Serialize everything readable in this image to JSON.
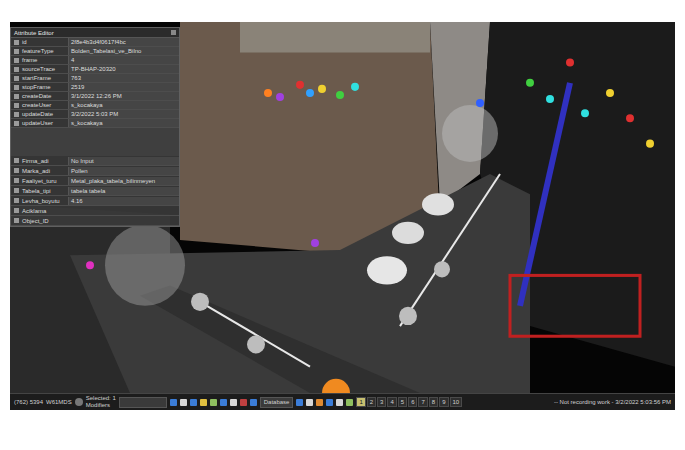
{
  "attribute_editor": {
    "title": "Attribute Editor",
    "system_fields": [
      {
        "key": "id",
        "value": "2f8e4b3d4f0617f4bc"
      },
      {
        "key": "featureType",
        "value": "Bolden_Tabelasi_ve_Bilno"
      },
      {
        "key": "frame",
        "value": "4"
      },
      {
        "key": "sourceTrace",
        "value": "TP-BHAP-20320"
      },
      {
        "key": "startFrame",
        "value": "763"
      },
      {
        "key": "stopFrame",
        "value": "2519"
      },
      {
        "key": "createDate",
        "value": "3/1/2022 12:26 PM"
      },
      {
        "key": "createUser",
        "value": "s_kocakaya"
      },
      {
        "key": "updateDate",
        "value": "3/2/2022 5:03 PM"
      },
      {
        "key": "updateUser",
        "value": "s_kocakaya"
      }
    ],
    "user_fields": [
      {
        "key": "Firma_adi",
        "value": "No Input"
      },
      {
        "key": "Marka_adi",
        "value": "Pollen"
      },
      {
        "key": "Faaliyet_turu",
        "value": "Metal_plaka_tabela_bilinmeyen"
      },
      {
        "key": "Tabela_tipi",
        "value": "tabela tabela"
      },
      {
        "key": "Levha_boyutu",
        "value": "4.16"
      },
      {
        "key": "Aciklama",
        "value": ""
      },
      {
        "key": "Object_ID",
        "value": ""
      }
    ]
  },
  "status_bar": {
    "coords": "(762) 5394",
    "station": "W61MDS",
    "selected": "Selected: 1",
    "selected_sub": "Modifiers",
    "layer": "Database",
    "pages": [
      {
        "label": "1",
        "selected": true
      },
      {
        "label": "2",
        "selected": false
      },
      {
        "label": "3",
        "selected": false
      },
      {
        "label": "4",
        "selected": false
      },
      {
        "label": "5",
        "selected": false
      },
      {
        "label": "6",
        "selected": false
      },
      {
        "label": "7",
        "selected": false
      },
      {
        "label": "8",
        "selected": false
      },
      {
        "label": "9",
        "selected": false
      },
      {
        "label": "10",
        "selected": false
      }
    ],
    "message": "-- Not recording work - 3/2/2022 5:03:56 PM"
  }
}
